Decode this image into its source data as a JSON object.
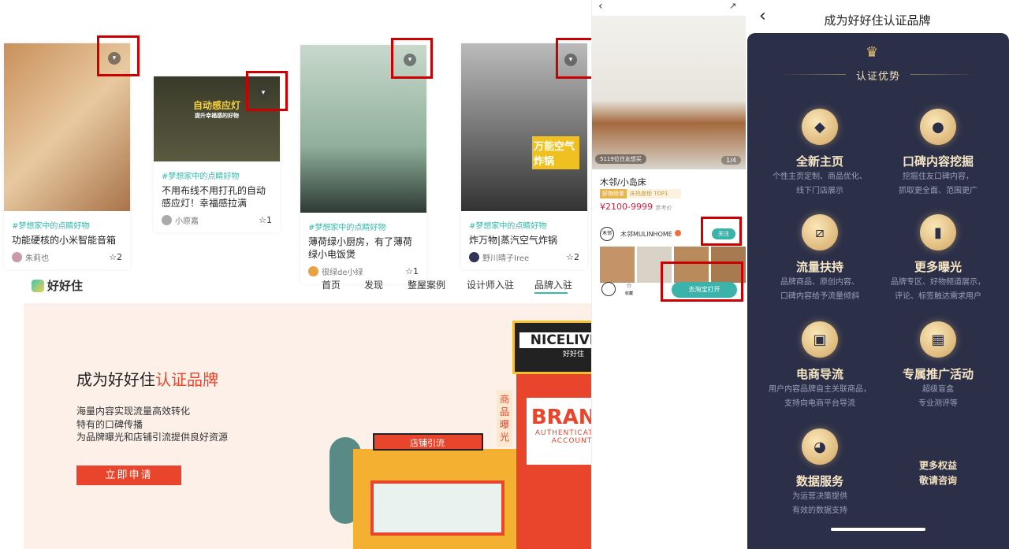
{
  "cards": [
    {
      "tag": "#梦想家中的点睛好物",
      "title": "功能硬核的小米智能音箱",
      "author": "朱莉也",
      "likes": "2"
    },
    {
      "tag": "#梦想家中的点睛好物",
      "title": "不用布线不用打孔的自动感应灯！幸福感拉满",
      "author": "小原嘉",
      "likes": "1",
      "image_text": "自动感应灯",
      "image_sub": "提升幸福感的好物"
    },
    {
      "tag": "#梦想家中的点睛好物",
      "title": "薄荷绿小厨房，有了薄荷绿小电饭煲",
      "author": "很绿de小绿",
      "likes": "1"
    },
    {
      "tag": "#梦想家中的点睛好物",
      "title": "炸万物|蒸汽空气炸锅",
      "author": "野川晴子Iree",
      "likes": "2",
      "image_text": "万能空气炸锅"
    }
  ],
  "site": {
    "logo": "好好住",
    "nav": [
      "首页",
      "发现",
      "整屋案例",
      "设计师入驻",
      "品牌入驻"
    ],
    "active_nav": "品牌入驻"
  },
  "banner": {
    "title_prefix": "成为好好住",
    "title_highlight": "认证品牌",
    "lines": [
      "海量内容实现流量高效转化",
      "特有的口碑传播",
      "为品牌曝光和店铺引流提供良好资源"
    ],
    "cta": "立即申请",
    "sign": "NICELIVING",
    "sign_sub": "好好住",
    "brand": "BRAND",
    "brand_sub1": "AUTHENTICATION",
    "brand_sub2": "ACCOUNT",
    "vertical": "商品曝光",
    "arrow_label": "店铺引流",
    "accent": "#e8452c"
  },
  "phone": {
    "img_badge": "5119位住友想买",
    "img_count": "1/4",
    "product": "木邻/小岛床",
    "badge1": "好物榜单",
    "badge2": "床热度榜 TOP1",
    "price": "¥2100-9999",
    "price_note": "参考价",
    "shop_logo": "木邻",
    "shop": "木邻MULINHOME",
    "follow": "关注",
    "fav": "收藏",
    "open": "去淘宝打开",
    "teal": "#3bb3aa"
  },
  "right": {
    "title": "成为好好住认证品牌",
    "section": "认证优势",
    "features": [
      {
        "icon": "diamond-icon",
        "title": "全新主页",
        "desc": [
          "个性主页定制、商品优化、",
          "线下门店展示"
        ]
      },
      {
        "icon": "chat-icon",
        "title": "口碑内容挖掘",
        "desc": [
          "挖掘住友口碑内容，",
          "抓取更全面、范围更广"
        ]
      },
      {
        "icon": "chart-line-icon",
        "title": "流量扶持",
        "desc": [
          "品牌商品、原创内容、",
          "口碑内容给予流量倾斜"
        ]
      },
      {
        "icon": "bar-chart-icon",
        "title": "更多曝光",
        "desc": [
          "品牌专区、好物频道展示，",
          "评论、标签触达需求用户"
        ]
      },
      {
        "icon": "bag-icon",
        "title": "电商导流",
        "desc": [
          "用户内容品牌自主关联商品，",
          "支持向电商平台导流"
        ]
      },
      {
        "icon": "gift-icon",
        "title": "专属推广活动",
        "desc": [
          "超级盲盒",
          "专业测评等"
        ]
      },
      {
        "icon": "pie-icon",
        "title": "数据服务",
        "desc": [
          "为运营决策提供",
          "有效的数据支持"
        ]
      }
    ],
    "more": [
      "更多权益",
      "敬请咨询"
    ]
  }
}
